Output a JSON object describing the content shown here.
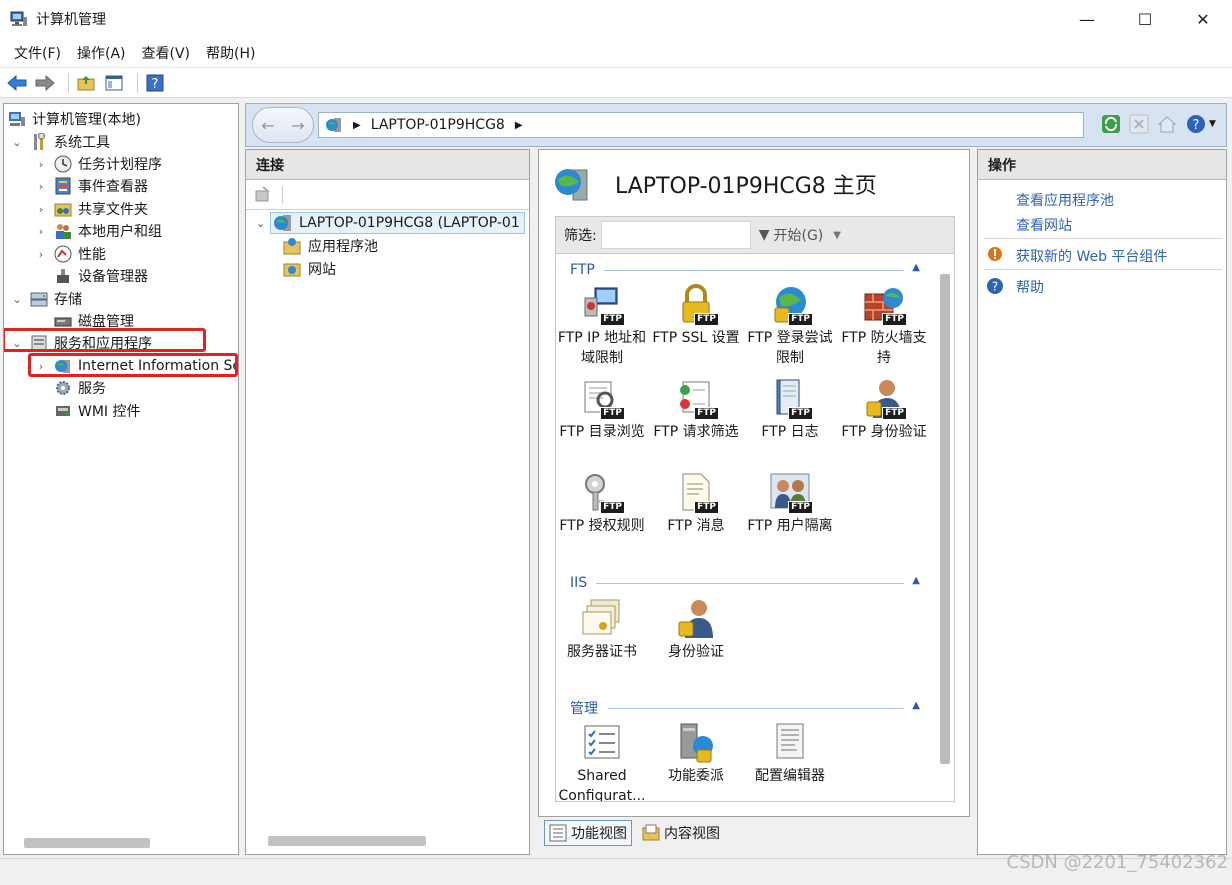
{
  "window": {
    "title": "计算机管理",
    "controls": [
      "—",
      "☐",
      "✕"
    ]
  },
  "menu": [
    "文件(F)",
    "操作(A)",
    "查看(V)",
    "帮助(H)"
  ],
  "tree": {
    "root": "计算机管理(本地)",
    "items": [
      {
        "label": "系统工具"
      },
      {
        "label": "任务计划程序"
      },
      {
        "label": "事件查看器"
      },
      {
        "label": "共享文件夹"
      },
      {
        "label": "本地用户和组"
      },
      {
        "label": "性能"
      },
      {
        "label": "设备管理器"
      },
      {
        "label": "存储"
      },
      {
        "label": "磁盘管理"
      },
      {
        "label": "服务和应用程序"
      },
      {
        "label": "Internet Information Se"
      },
      {
        "label": "服务"
      },
      {
        "label": "WMI 控件"
      }
    ]
  },
  "iis": {
    "address": "LAPTOP-01P9HCG8",
    "connections": {
      "header": "连接",
      "server": "LAPTOP-01P9HCG8 (LAPTOP-01",
      "app_pools": "应用程序池",
      "sites": "网站"
    },
    "main": {
      "title": "LAPTOP-01P9HCG8 主页",
      "filter_label": "筛选:",
      "filter_value": "",
      "go_label": "开始(G)",
      "groups": [
        {
          "name": "FTP",
          "features": [
            "FTP IP 地址和域限制",
            "FTP SSL 设置",
            "FTP 登录尝试限制",
            "FTP 防火墙支持",
            "FTP 目录浏览",
            "FTP 请求筛选",
            "FTP 日志",
            "FTP 身份验证",
            "FTP 授权规则",
            "FTP 消息",
            "FTP 用户隔离"
          ]
        },
        {
          "name": "IIS",
          "features": [
            "服务器证书",
            "身份验证"
          ]
        },
        {
          "name": "管理",
          "features": [
            "Shared Configurat...",
            "功能委派",
            "配置编辑器"
          ]
        }
      ]
    },
    "view_tabs": [
      "功能视图",
      "内容视图"
    ],
    "actions": {
      "header": "操作",
      "links": [
        "查看应用程序池",
        "查看网站",
        "获取新的 Web 平台组件",
        "帮助"
      ]
    }
  },
  "watermark": "CSDN @2201_75402362",
  "colors": {
    "highlight": "#e3211d",
    "link": "#2e63b5",
    "group": "#2a5aa8"
  }
}
